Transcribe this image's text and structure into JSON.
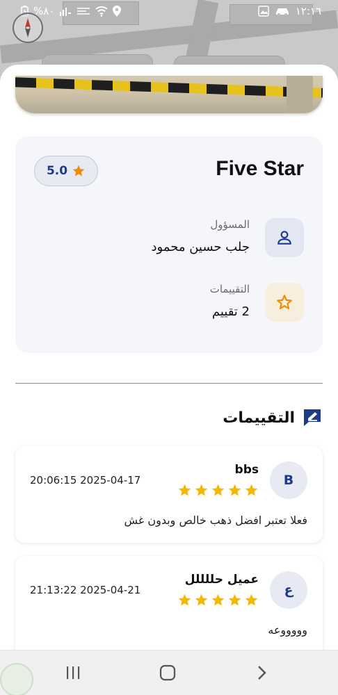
{
  "status_bar": {
    "time": "١٢:١٦",
    "battery": "%٨٠"
  },
  "shop": {
    "name": "Five Star",
    "rating": "5.0",
    "manager_label": "المسؤول",
    "manager_name": "جلب حسين محمود",
    "ratings_label": "التقييمات",
    "ratings_count": "2 تقييم"
  },
  "reviews_section": {
    "title": "التقييمات",
    "items": [
      {
        "initial": "B",
        "name": "bbs",
        "stars": 5,
        "date": "20:06:15 2025-04-17",
        "text": "فعلا تعتبر افضل ذهب خالص وبدون غش"
      },
      {
        "initial": "ع",
        "name": "عميل حللللل",
        "stars": 5,
        "date": "21:13:22 2025-04-21",
        "text": "ﻭﻭﻭﻭﻭﻋﻪ"
      }
    ]
  },
  "colors": {
    "accent": "#1e3a8a",
    "star": "#f5b800",
    "orange": "#f08c00"
  },
  "icons": {
    "rating_star": "star-icon",
    "manager": "person-icon",
    "ratings": "star-outline-icon",
    "reviews_title": "edit-note-icon",
    "nav_recents": "recents-icon",
    "nav_home": "home-icon",
    "nav_back": "back-icon"
  }
}
